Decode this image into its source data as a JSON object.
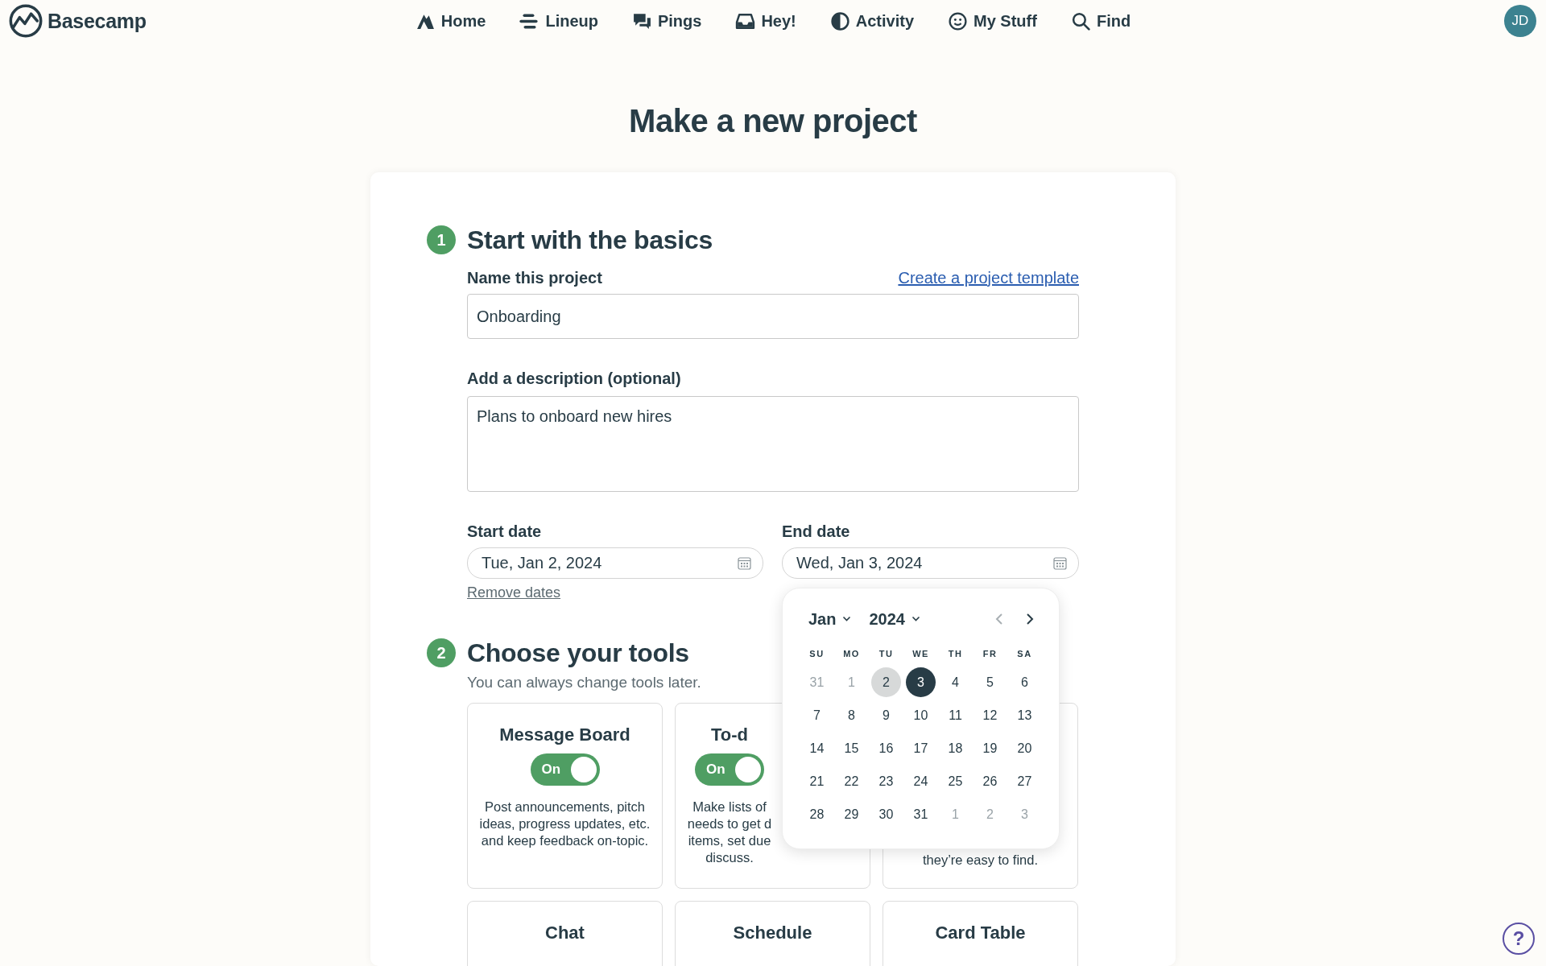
{
  "nav": {
    "logo": "Basecamp",
    "items": [
      {
        "label": "Home"
      },
      {
        "label": "Lineup"
      },
      {
        "label": "Pings"
      },
      {
        "label": "Hey!"
      },
      {
        "label": "Activity"
      },
      {
        "label": "My Stuff"
      },
      {
        "label": "Find"
      }
    ],
    "avatar": "JD"
  },
  "page_title": "Make a new project",
  "basics": {
    "number": "1",
    "heading": "Start with the basics",
    "name_label": "Name this project",
    "template_link": "Create a project template",
    "name_value": "Onboarding",
    "description_label": "Add a description (optional)",
    "description_value": "Plans to onboard new hires",
    "start_label": "Start date",
    "start_value": "Tue, Jan 2, 2024",
    "end_label": "End date",
    "end_value": "Wed, Jan 3, 2024",
    "remove_dates": "Remove dates"
  },
  "calendar": {
    "month": "Jan",
    "year": "2024",
    "prev_disabled": true,
    "next_disabled": false,
    "weekdays": [
      "SU",
      "MO",
      "TU",
      "WE",
      "TH",
      "FR",
      "SA"
    ],
    "days": [
      {
        "label": "31",
        "muted": true,
        "selected": false,
        "range_start": false
      },
      {
        "label": "1",
        "muted": true,
        "selected": false,
        "range_start": false
      },
      {
        "label": "2",
        "muted": false,
        "selected": false,
        "range_start": true
      },
      {
        "label": "3",
        "muted": false,
        "selected": true,
        "range_start": false
      },
      {
        "label": "4",
        "muted": false,
        "selected": false,
        "range_start": false
      },
      {
        "label": "5",
        "muted": false,
        "selected": false,
        "range_start": false
      },
      {
        "label": "6",
        "muted": false,
        "selected": false,
        "range_start": false
      },
      {
        "label": "7",
        "muted": false,
        "selected": false,
        "range_start": false
      },
      {
        "label": "8",
        "muted": false,
        "selected": false,
        "range_start": false
      },
      {
        "label": "9",
        "muted": false,
        "selected": false,
        "range_start": false
      },
      {
        "label": "10",
        "muted": false,
        "selected": false,
        "range_start": false
      },
      {
        "label": "11",
        "muted": false,
        "selected": false,
        "range_start": false
      },
      {
        "label": "12",
        "muted": false,
        "selected": false,
        "range_start": false
      },
      {
        "label": "13",
        "muted": false,
        "selected": false,
        "range_start": false
      },
      {
        "label": "14",
        "muted": false,
        "selected": false,
        "range_start": false
      },
      {
        "label": "15",
        "muted": false,
        "selected": false,
        "range_start": false
      },
      {
        "label": "16",
        "muted": false,
        "selected": false,
        "range_start": false
      },
      {
        "label": "17",
        "muted": false,
        "selected": false,
        "range_start": false
      },
      {
        "label": "18",
        "muted": false,
        "selected": false,
        "range_start": false
      },
      {
        "label": "19",
        "muted": false,
        "selected": false,
        "range_start": false
      },
      {
        "label": "20",
        "muted": false,
        "selected": false,
        "range_start": false
      },
      {
        "label": "21",
        "muted": false,
        "selected": false,
        "range_start": false
      },
      {
        "label": "22",
        "muted": false,
        "selected": false,
        "range_start": false
      },
      {
        "label": "23",
        "muted": false,
        "selected": false,
        "range_start": false
      },
      {
        "label": "24",
        "muted": false,
        "selected": false,
        "range_start": false
      },
      {
        "label": "25",
        "muted": false,
        "selected": false,
        "range_start": false
      },
      {
        "label": "26",
        "muted": false,
        "selected": false,
        "range_start": false
      },
      {
        "label": "27",
        "muted": false,
        "selected": false,
        "range_start": false
      },
      {
        "label": "28",
        "muted": false,
        "selected": false,
        "range_start": false
      },
      {
        "label": "29",
        "muted": false,
        "selected": false,
        "range_start": false
      },
      {
        "label": "30",
        "muted": false,
        "selected": false,
        "range_start": false
      },
      {
        "label": "31",
        "muted": false,
        "selected": false,
        "range_start": false
      },
      {
        "label": "1",
        "muted": true,
        "selected": false,
        "range_start": false
      },
      {
        "label": "2",
        "muted": true,
        "selected": false,
        "range_start": false
      },
      {
        "label": "3",
        "muted": true,
        "selected": false,
        "range_start": false
      }
    ]
  },
  "tools": {
    "number": "2",
    "heading": "Choose your tools",
    "subtitle": "You can always change tools later.",
    "cards": [
      {
        "kind": "full",
        "title": "Message Board",
        "toggle": {
          "on": true,
          "label": "On"
        },
        "description": "Post announcements, pitch ideas, progress updates, etc. and keep feedback on-topic."
      },
      {
        "kind": "covered-right",
        "title": "To-d",
        "toggle": {
          "on": true,
          "label": "On"
        },
        "lines": [
          "Make lists of",
          "needs to get d",
          "items, set due",
          "discuss."
        ]
      },
      {
        "kind": "covered-top",
        "lines": [
          "they’re easy to find."
        ]
      },
      {
        "kind": "full",
        "title": "Chat"
      },
      {
        "kind": "full",
        "title": "Schedule"
      },
      {
        "kind": "full",
        "title": "Card Table"
      }
    ]
  },
  "help": {
    "label": "?"
  }
}
